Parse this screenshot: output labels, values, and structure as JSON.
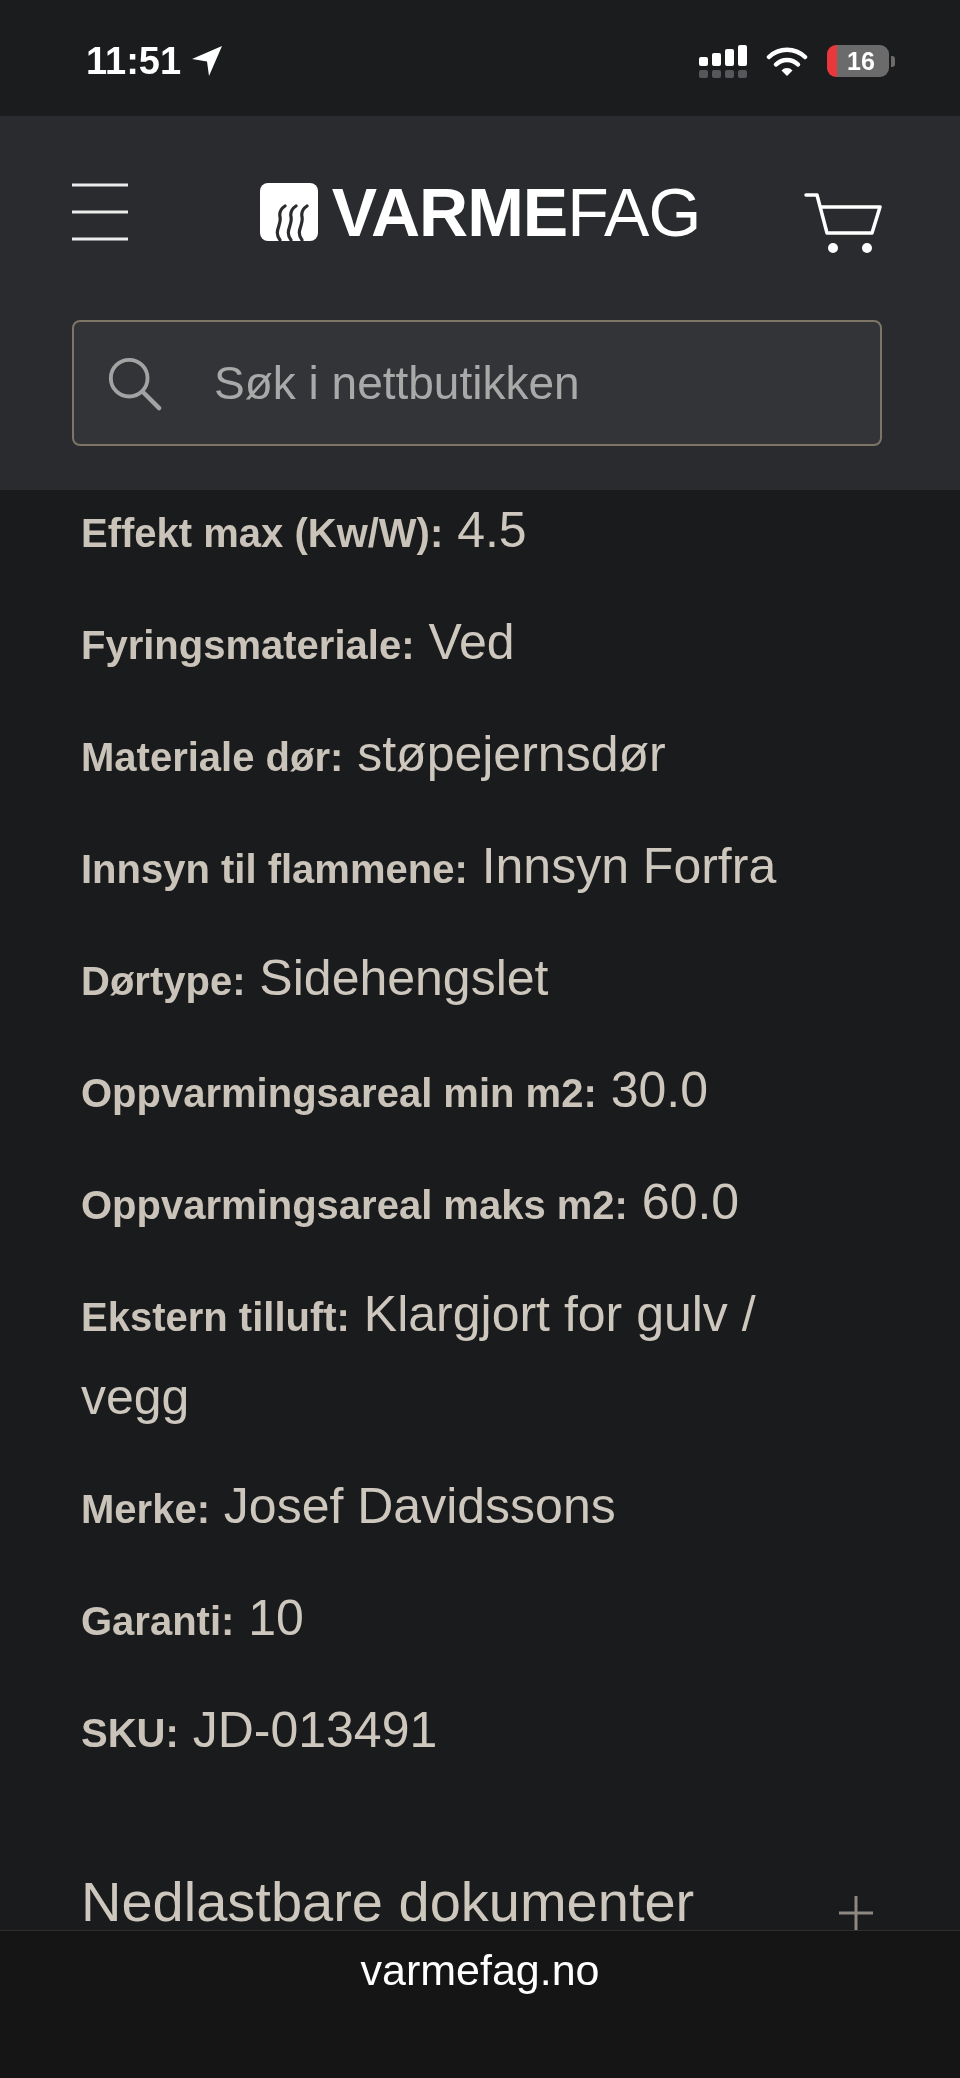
{
  "status_bar": {
    "time": "11:51",
    "battery": "16"
  },
  "header": {
    "logo": "**VARME**FAG",
    "search": {
      "placeholder": "Søk i nettbutikken"
    }
  },
  "specs": [
    {
      "label": "Effekt max (Kw/W):",
      "value": "4.5"
    },
    {
      "label": "Fyringsmateriale:",
      "value": "Ved"
    },
    {
      "label": "Materiale dør:",
      "value": "støpejernsdør"
    },
    {
      "label": "Innsyn til flammene:",
      "value": "Innsyn Forfra"
    },
    {
      "label": "Dørtype:",
      "value": "Sidehengslet"
    },
    {
      "label": "Oppvarmingsareal min m2:",
      "value": "30.0"
    },
    {
      "label": "Oppvarmingsareal maks m2:",
      "value": "60.0"
    },
    {
      "label": "Ekstern tilluft:",
      "value": "Klargjort for gulv / vegg"
    },
    {
      "label": "Merke:",
      "value": "Josef Davidssons"
    },
    {
      "label": "Garanti:",
      "value": "10"
    },
    {
      "label": "SKU:",
      "value": "JD-013491"
    }
  ],
  "downloads": {
    "title": "Nedlastbare dokumenter",
    "expanded": false
  },
  "address_bar": {
    "url": "varmefag.no"
  }
}
